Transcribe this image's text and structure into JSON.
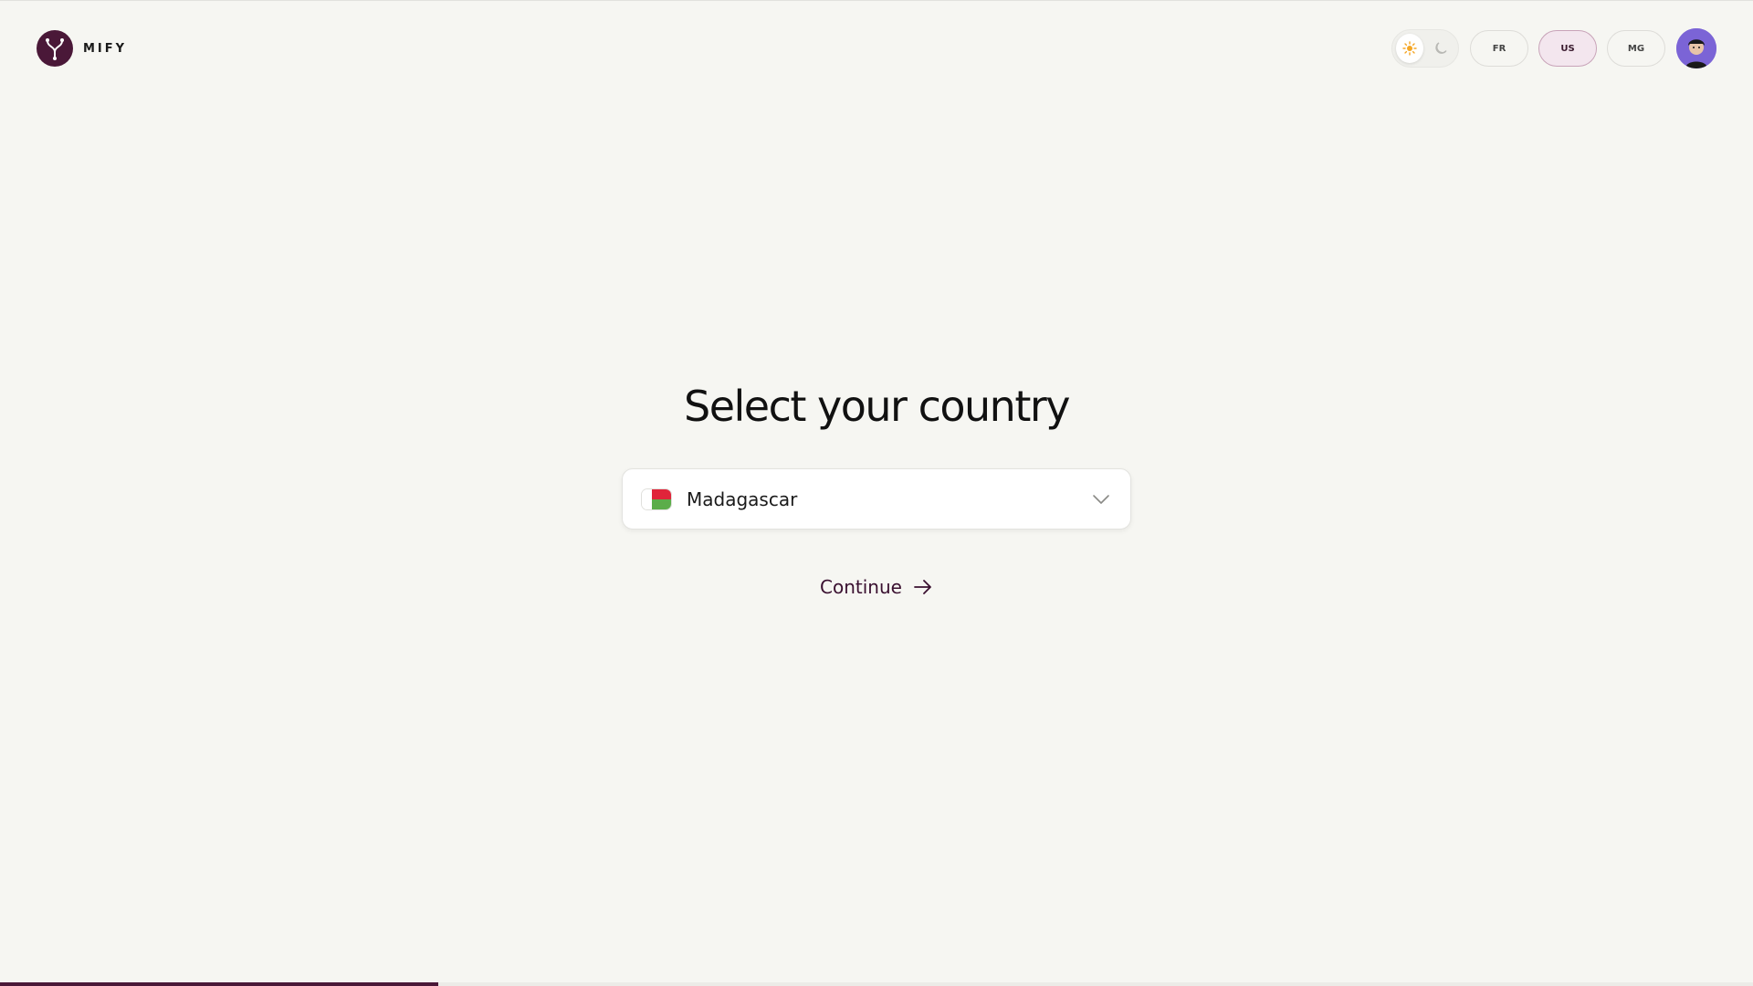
{
  "header": {
    "brand_name": "MIFY",
    "theme": {
      "light_icon": "sun-icon",
      "dark_icon": "moon-icon",
      "active": "light"
    },
    "languages": [
      {
        "code": "FR",
        "active": false
      },
      {
        "code": "US",
        "active": true
      },
      {
        "code": "MG",
        "active": false
      }
    ]
  },
  "main": {
    "title": "Select your country",
    "country_select": {
      "value": "Madagascar",
      "flag": "madagascar-flag"
    },
    "continue_label": "Continue"
  },
  "progress": {
    "fraction": 0.25
  },
  "colors": {
    "background": "#f6f6f2",
    "brand": "#4a1838",
    "accent_text": "#3a1030",
    "active_lang_bg": "#f3e6ee",
    "sun": "#f5a623"
  }
}
